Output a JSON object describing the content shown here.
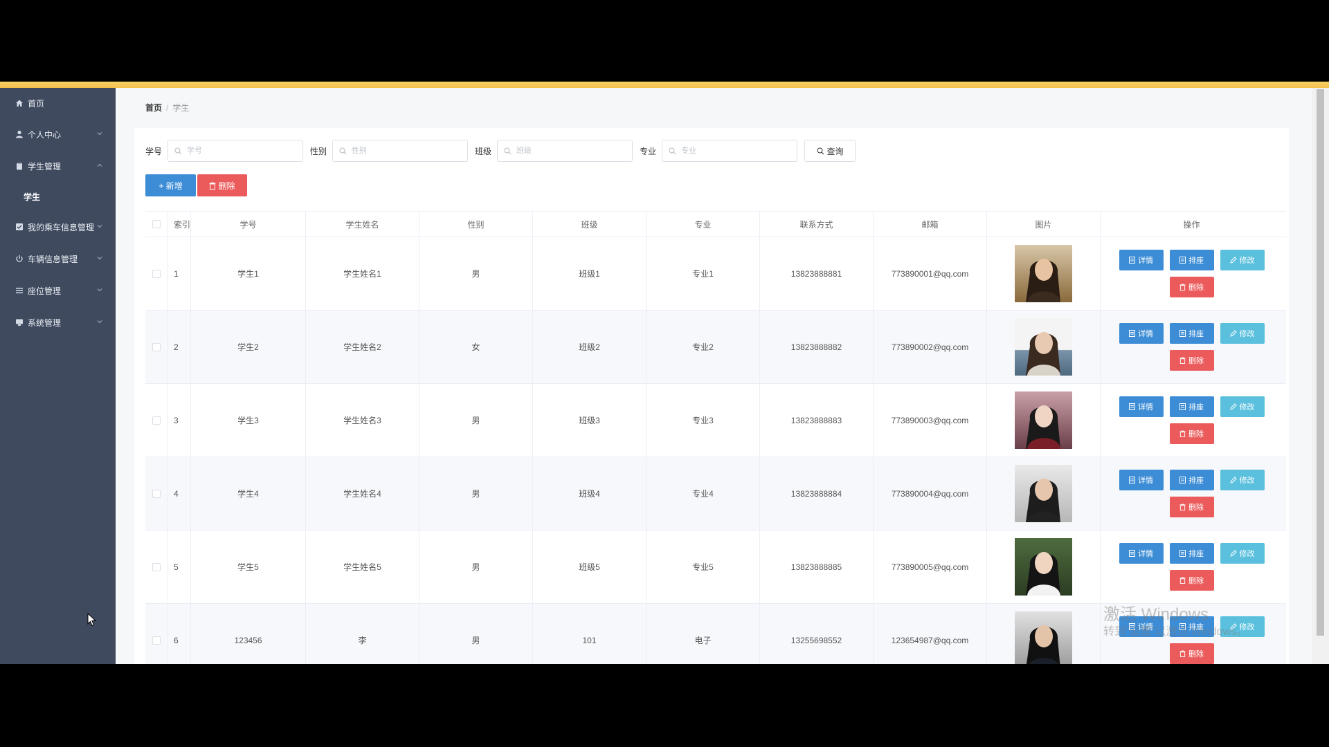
{
  "sidebar": {
    "items": [
      {
        "label": "首页",
        "icon": "home-icon"
      },
      {
        "label": "个人中心",
        "icon": "user-icon"
      },
      {
        "label": "学生管理",
        "icon": "clipboard-icon"
      },
      {
        "label": "学生",
        "icon": ""
      },
      {
        "label": "我的乘车信息管理",
        "icon": "checkbox-icon"
      },
      {
        "label": "车辆信息管理",
        "icon": "power-icon"
      },
      {
        "label": "座位管理",
        "icon": "list-icon"
      },
      {
        "label": "系统管理",
        "icon": "monitor-icon"
      }
    ]
  },
  "breadcrumb": {
    "home": "首页",
    "separator": "/",
    "current": "学生"
  },
  "search": {
    "fields": [
      {
        "label": "学号",
        "placeholder": "学号"
      },
      {
        "label": "性别",
        "placeholder": "性别"
      },
      {
        "label": "班级",
        "placeholder": "班级"
      },
      {
        "label": "专业",
        "placeholder": "专业"
      }
    ],
    "query_label": "查询"
  },
  "actions": {
    "add_label": "新增",
    "delete_label": "删除"
  },
  "table": {
    "columns": [
      "索引",
      "学号",
      "学生姓名",
      "性别",
      "班级",
      "专业",
      "联系方式",
      "邮箱",
      "图片",
      "操作"
    ],
    "op_labels": {
      "detail": "详情",
      "seat": "排座",
      "edit": "修改",
      "delete": "删除"
    },
    "rows": [
      {
        "index": "1",
        "id": "学生1",
        "name": "学生姓名1",
        "gender": "男",
        "class": "班级1",
        "major": "专业1",
        "phone": "13823888881",
        "email": "773890001@qq.com"
      },
      {
        "index": "2",
        "id": "学生2",
        "name": "学生姓名2",
        "gender": "女",
        "class": "班级2",
        "major": "专业2",
        "phone": "13823888882",
        "email": "773890002@qq.com"
      },
      {
        "index": "3",
        "id": "学生3",
        "name": "学生姓名3",
        "gender": "男",
        "class": "班级3",
        "major": "专业3",
        "phone": "13823888883",
        "email": "773890003@qq.com"
      },
      {
        "index": "4",
        "id": "学生4",
        "name": "学生姓名4",
        "gender": "男",
        "class": "班级4",
        "major": "专业4",
        "phone": "13823888884",
        "email": "773890004@qq.com"
      },
      {
        "index": "5",
        "id": "学生5",
        "name": "学生姓名5",
        "gender": "男",
        "class": "班级5",
        "major": "专业5",
        "phone": "13823888885",
        "email": "773890005@qq.com"
      },
      {
        "index": "6",
        "id": "123456",
        "name": "李",
        "gender": "男",
        "class": "101",
        "major": "电子",
        "phone": "13255698552",
        "email": "123654987@qq.com"
      }
    ]
  },
  "watermark": {
    "line1": "激活 Windows",
    "line2": "转到“设置”以激活 Windows。"
  },
  "colors": {
    "sidebar": "#3f4a5f",
    "primary": "#3d8dd6",
    "danger": "#ec5b5b",
    "info": "#5bc0de",
    "accent": "#f3c14c"
  }
}
